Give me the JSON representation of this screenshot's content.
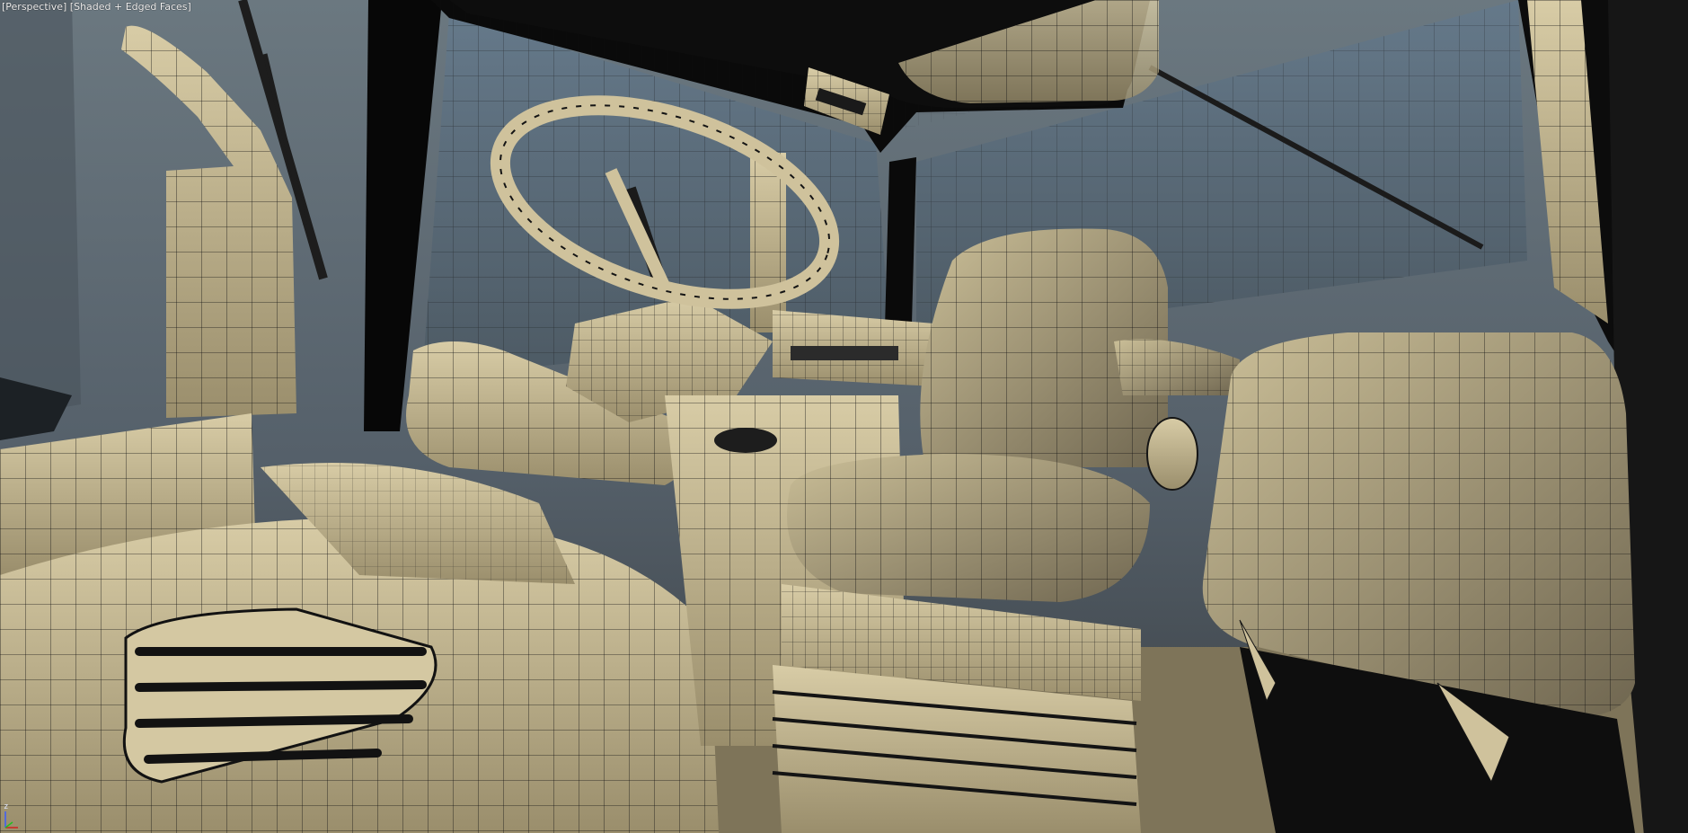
{
  "viewport": {
    "view_label": "[Perspective]",
    "shading_label": "[Shaded + Edged Faces]",
    "axis_gizmo": {
      "z_label": "z",
      "icon": "axis-tripod-icon"
    }
  },
  "colors": {
    "sky": "#6b7880",
    "glass": "#5e7282",
    "mesh_fill": "#cfc29c",
    "mesh_shadow": "#7d7358",
    "edge_lines": "#141414",
    "frame": "#050505",
    "floor": "#8a7f63"
  }
}
